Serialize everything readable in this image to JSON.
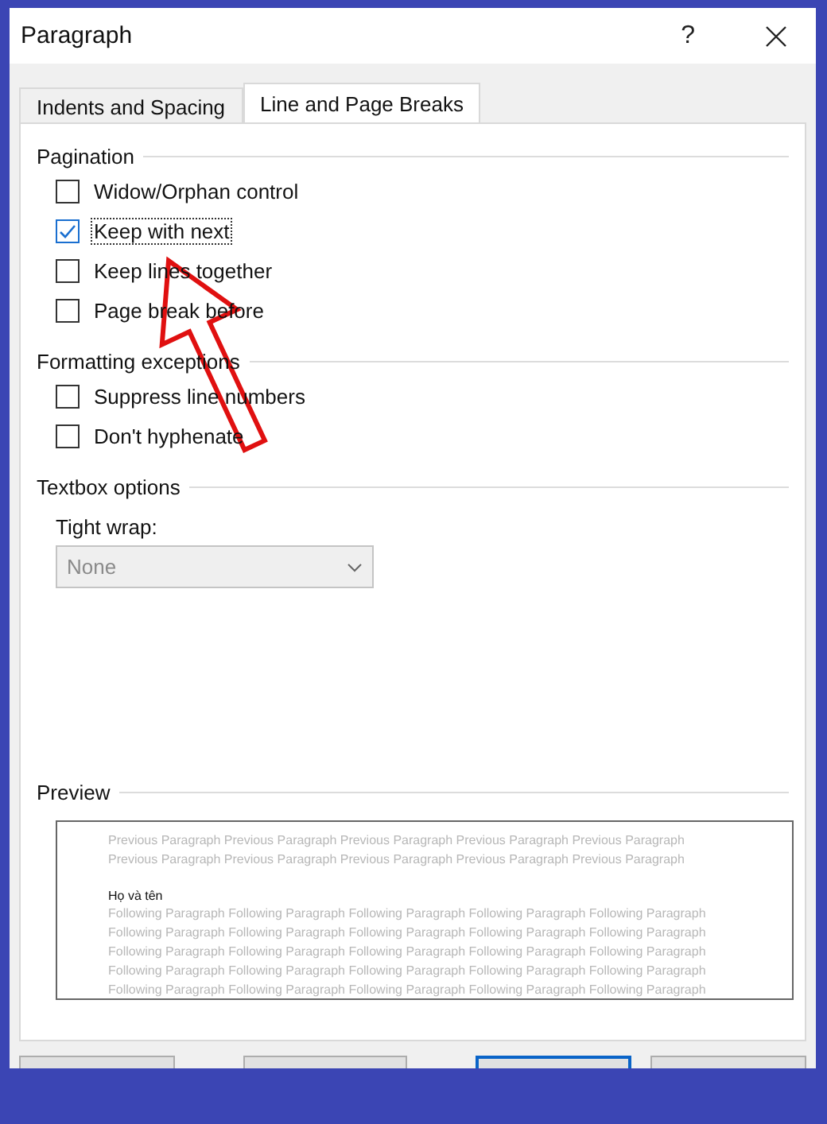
{
  "window": {
    "title": "Paragraph",
    "help": "?"
  },
  "tabs": [
    {
      "label": "Indents and Spacing",
      "selected": false
    },
    {
      "label": "Line and Page Breaks",
      "selected": true
    }
  ],
  "sections": [
    {
      "title": "Pagination",
      "items": [
        {
          "kind": "checkbox",
          "label": "Widow/Orphan control",
          "checked": false,
          "focused": false
        },
        {
          "kind": "checkbox",
          "label": "Keep with next",
          "checked": true,
          "focused": true
        },
        {
          "kind": "checkbox",
          "label": "Keep lines together",
          "checked": false,
          "focused": false
        },
        {
          "kind": "checkbox",
          "label": "Page break before",
          "checked": false,
          "focused": false
        }
      ]
    },
    {
      "title": "Formatting exceptions",
      "items": [
        {
          "kind": "checkbox",
          "label": "Suppress line numbers",
          "checked": false,
          "focused": false
        },
        {
          "kind": "checkbox",
          "label": "Don't hyphenate",
          "checked": false,
          "focused": false
        }
      ]
    },
    {
      "title": "Textbox options",
      "items": [
        {
          "kind": "dropdown",
          "label": "Tight wrap:",
          "value": "None",
          "disabled": true
        }
      ]
    }
  ],
  "preview": {
    "title": "Preview",
    "previous_lines": [
      "Previous Paragraph Previous Paragraph Previous Paragraph Previous Paragraph Previous Paragraph",
      "Previous Paragraph Previous Paragraph Previous Paragraph Previous Paragraph Previous Paragraph"
    ],
    "sample": "Họ và tên",
    "following_lines": [
      "Following Paragraph Following Paragraph Following Paragraph Following Paragraph Following Paragraph",
      "Following Paragraph Following Paragraph Following Paragraph Following Paragraph Following Paragraph",
      "Following Paragraph Following Paragraph Following Paragraph Following Paragraph Following Paragraph",
      "Following Paragraph Following Paragraph Following Paragraph Following Paragraph Following Paragraph",
      "Following Paragraph Following Paragraph Following Paragraph Following Paragraph Following Paragraph"
    ]
  }
}
